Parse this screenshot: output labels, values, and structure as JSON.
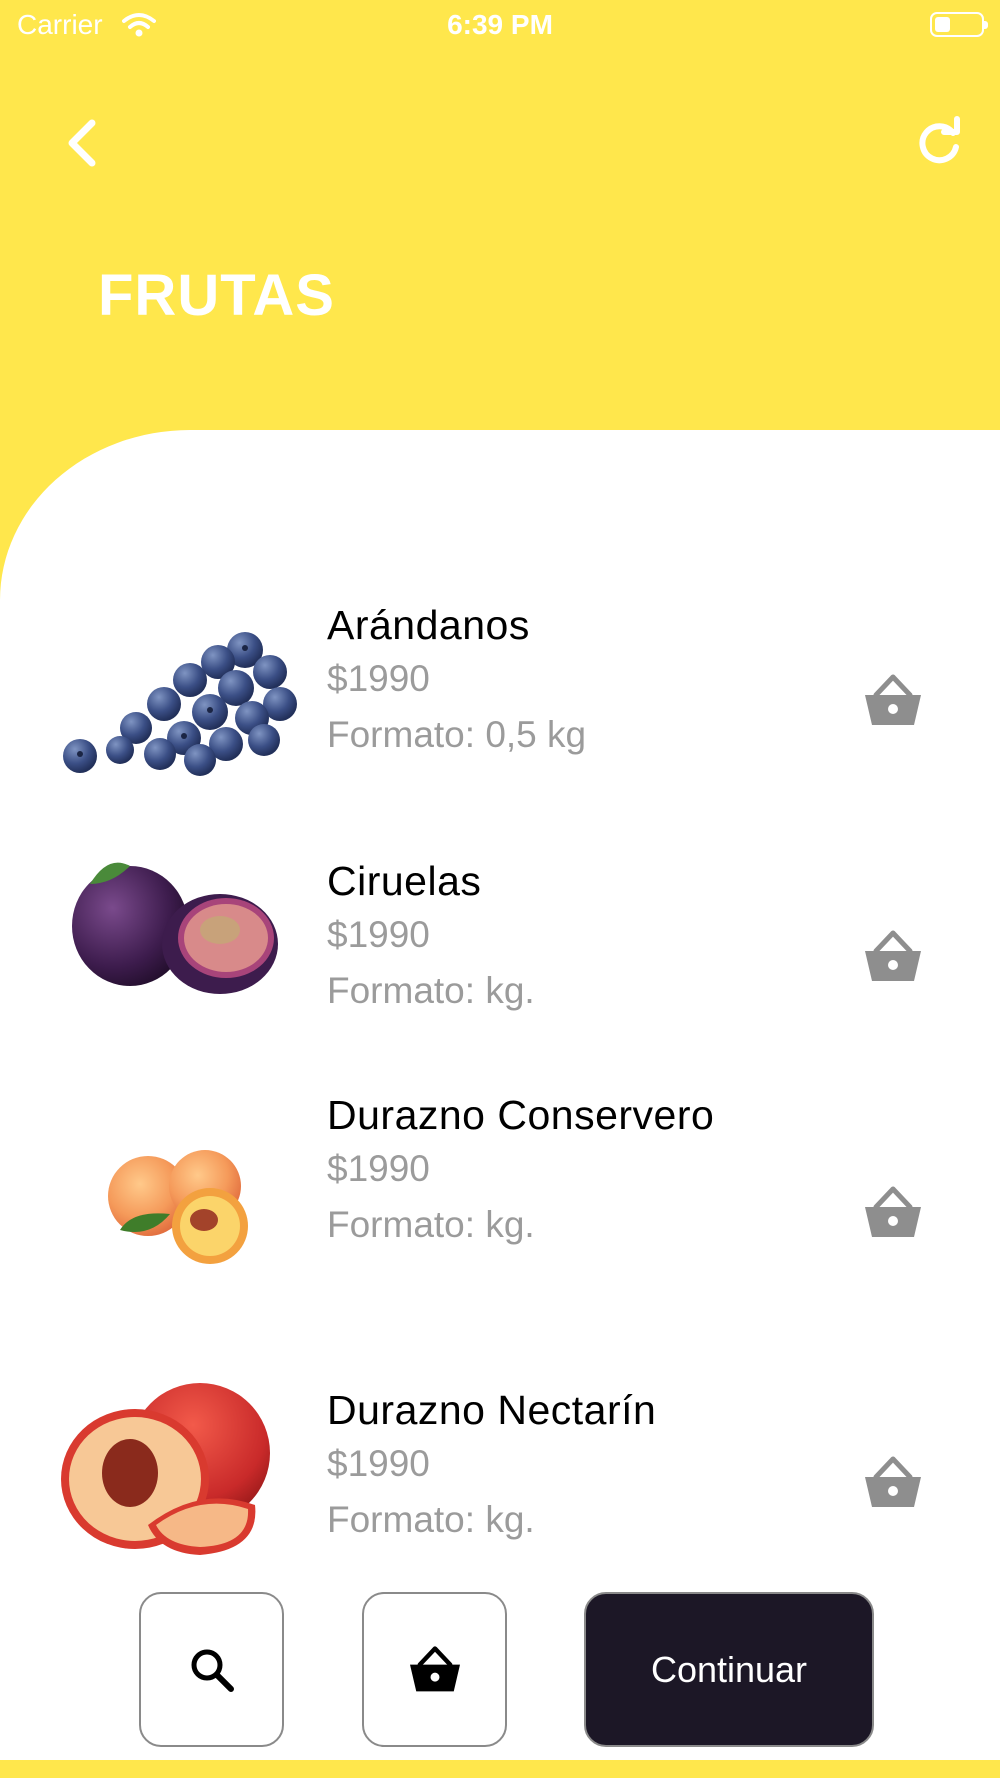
{
  "status_bar": {
    "carrier": "Carrier",
    "time": "6:39 PM"
  },
  "header": {
    "title": "FRUTAS",
    "back_icon": "chevron-left-icon",
    "refresh_icon": "refresh-icon"
  },
  "products": [
    {
      "name": "Arándanos",
      "price": "$1990",
      "format": "Formato: 0,5 kg",
      "image": "blueberries"
    },
    {
      "name": "Ciruelas",
      "price": "$1990",
      "format": "Formato: kg.",
      "image": "plums"
    },
    {
      "name": "Durazno Conservero",
      "price": "$1990",
      "format": "Formato: kg.",
      "image": "peaches"
    },
    {
      "name": "Durazno Nectarín",
      "price": "$1990",
      "format": "Formato: kg.",
      "image": "nectarine"
    }
  ],
  "bottom_bar": {
    "search_icon": "search-icon",
    "basket_icon": "basket-icon",
    "continue_label": "Continuar"
  },
  "colors": {
    "brand_yellow": "#FFE74C",
    "continue_bg": "#1C1726",
    "secondary_text": "#9B9B9B",
    "cart_icon": "#8E8E8E"
  }
}
